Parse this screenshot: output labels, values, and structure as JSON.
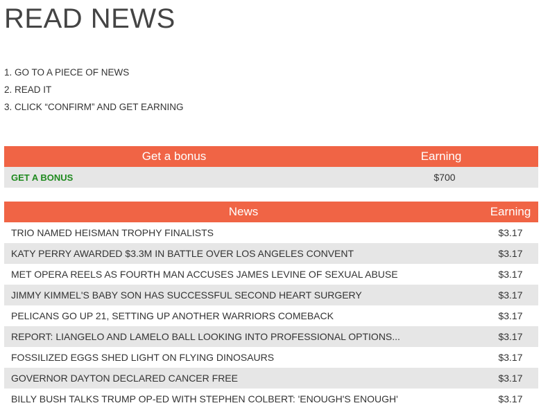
{
  "page": {
    "title": "READ NEWS",
    "steps": [
      "1. GO TO A PIECE OF NEWS",
      "2. READ IT",
      "3. CLICK “CONFIRM” AND GET EARNING"
    ]
  },
  "bonus_table": {
    "headers": {
      "main": "Get a bonus",
      "earning": "Earning"
    },
    "rows": [
      {
        "label": "GET A BONUS",
        "earning": "$700"
      }
    ]
  },
  "news_table": {
    "headers": {
      "main": "News",
      "earning": "Earning"
    },
    "rows": [
      {
        "title": "TRIO NAMED HEISMAN TROPHY FINALISTS",
        "earning": "$3.17"
      },
      {
        "title": "KATY PERRY AWARDED $3.3M IN BATTLE OVER LOS ANGELES CONVENT",
        "earning": "$3.17"
      },
      {
        "title": "MET OPERA REELS AS FOURTH MAN ACCUSES JAMES LEVINE OF SEXUAL ABUSE",
        "earning": "$3.17"
      },
      {
        "title": "JIMMY KIMMEL'S BABY SON HAS SUCCESSFUL SECOND HEART SURGERY",
        "earning": "$3.17"
      },
      {
        "title": "PELICANS GO UP 21, SETTING UP ANOTHER WARRIORS COMEBACK",
        "earning": "$3.17"
      },
      {
        "title": "REPORT: LIANGELO AND LAMELO BALL LOOKING INTO PROFESSIONAL OPTIONS...",
        "earning": "$3.17"
      },
      {
        "title": "FOSSILIZED EGGS SHED LIGHT ON FLYING DINOSAURS",
        "earning": "$3.17"
      },
      {
        "title": "GOVERNOR DAYTON DECLARED CANCER FREE",
        "earning": "$3.17"
      },
      {
        "title": "BILLY BUSH TALKS TRUMP OP-ED WITH STEPHEN COLBERT: 'ENOUGH'S ENOUGH'",
        "earning": "$3.17"
      }
    ]
  },
  "colors": {
    "header_bg": "#f06445",
    "alt_row_bg": "#e6e6e6",
    "bonus_link": "#1f8a1f"
  }
}
